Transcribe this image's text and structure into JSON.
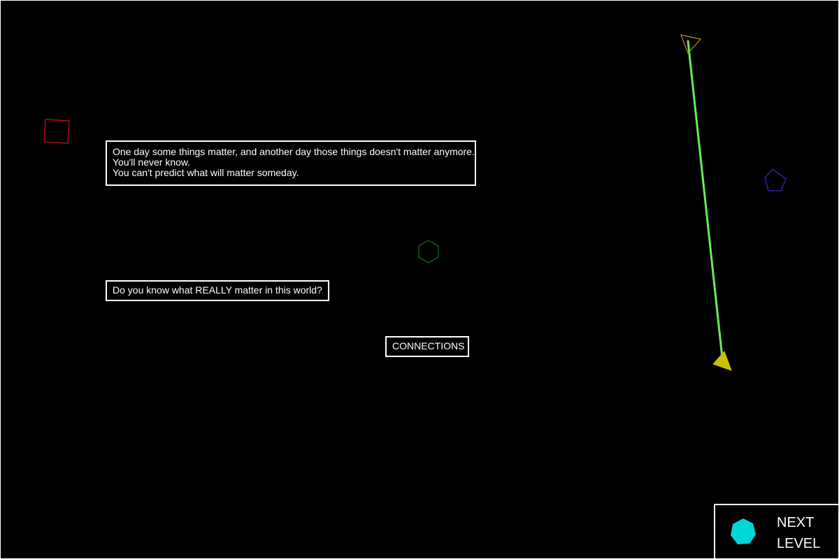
{
  "message": {
    "lines": [
      "One day some things matter, and another day those things doesn't matter anymore.",
      "You'll never know.",
      "You can't predict what will matter someday."
    ]
  },
  "question": {
    "text": "Do you know what REALLY matter in this world?"
  },
  "connections_button": {
    "label": "CONNECTIONS"
  },
  "next_level": {
    "label": "NEXT\nLEVEL",
    "icon": "cyan-heptagon-icon"
  },
  "colors": {
    "background": "#000000",
    "text": "#ffffff",
    "square": "#cc1111",
    "pentagon": "#4a1fcc",
    "hexagon": "#1a6a1a",
    "triangle_outline": "#b39b00",
    "triangle_filled": "#c8c000",
    "connector_line": "#66ee55",
    "next_level_shape": "#00d6d6"
  },
  "shapes": [
    {
      "name": "red-square-icon",
      "kind": "square",
      "filled": false
    },
    {
      "name": "purple-pentagon-icon",
      "kind": "pentagon",
      "filled": false
    },
    {
      "name": "green-hexagon-icon",
      "kind": "hexagon",
      "filled": false
    },
    {
      "name": "outline-triangle-icon",
      "kind": "triangle",
      "filled": false
    },
    {
      "name": "filled-triangle-icon",
      "kind": "triangle",
      "filled": true
    }
  ]
}
